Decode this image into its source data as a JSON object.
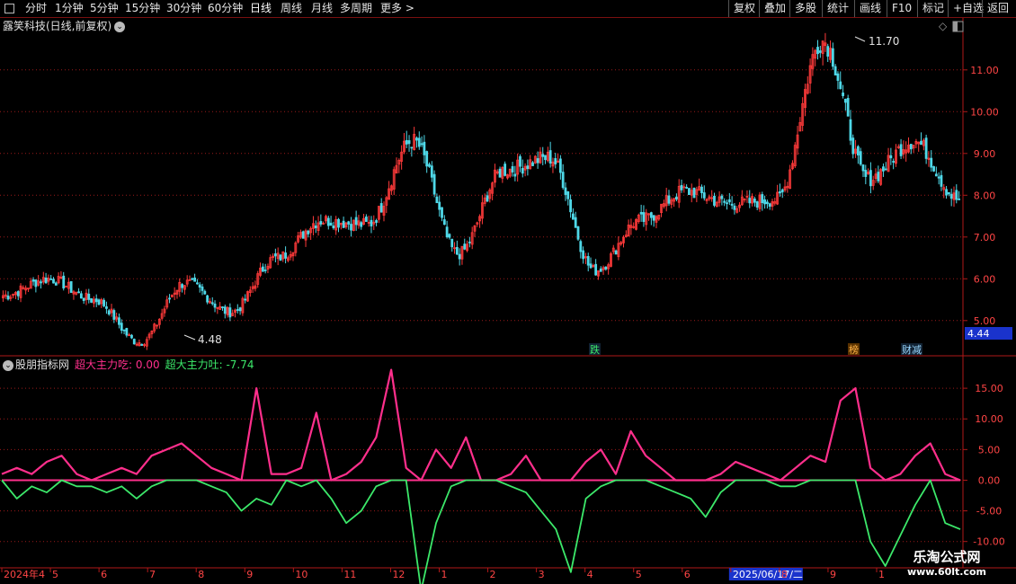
{
  "toolbar": {
    "periods": [
      "分时",
      "1分钟",
      "5分钟",
      "15分钟",
      "30分钟",
      "60分钟",
      "日线",
      "周线",
      "月线",
      "多周期",
      "更多 >"
    ],
    "active_period": "日线",
    "right_buttons": [
      "复权",
      "叠加",
      "多股",
      "统计",
      "画线",
      "F10",
      "标记",
      "+自选",
      "返回"
    ]
  },
  "main_panel": {
    "title": "露笑科技(日线,前复权)",
    "max_label": "11.70",
    "min_label": "4.48",
    "current_price": "4.44"
  },
  "events": [
    "跌",
    "榜",
    "财减"
  ],
  "indicator": {
    "name": "股朋指标网",
    "series1": "超大主力吃: 0.00",
    "series2": "超大主力吐: -7.74"
  },
  "x_axis": [
    "2024年4",
    "5",
    "6",
    "7",
    "8",
    "9",
    "10",
    "11",
    "12",
    "1",
    "2",
    "3",
    "4",
    "5",
    "6",
    "2025/06/17/二",
    "8",
    "9",
    "1"
  ],
  "logo": {
    "name": "乐淘公式网",
    "url": "www.60lt.com"
  },
  "colors": {
    "up": "#ff3a3a",
    "down": "#4fd8e8",
    "series1": "#ff2f8c",
    "series2": "#3ce86a",
    "grid": "#9a1a1a"
  },
  "chart_data": [
    {
      "type": "candlestick",
      "title": "露笑科技(日线,前复权)",
      "y_axis_ticks": [
        5.0,
        6.0,
        7.0,
        8.0,
        9.0,
        10.0,
        11.0
      ],
      "ylim": [
        4.2,
        12.2
      ],
      "key_points": [
        {
          "x": "2024-04",
          "y": 5.6
        },
        {
          "x": "2024-05",
          "y": 6.0
        },
        {
          "x": "2024-06",
          "y": 5.5
        },
        {
          "x": "2024-07",
          "y": 4.48
        },
        {
          "x": "2024-08",
          "y": 5.9
        },
        {
          "x": "2024-09",
          "y": 5.2
        },
        {
          "x": "2024-10",
          "y": 6.5
        },
        {
          "x": "2024-11",
          "y": 7.4
        },
        {
          "x": "2024-12",
          "y": 7.3
        },
        {
          "x": "2025-01",
          "y": 9.3
        },
        {
          "x": "2025-01",
          "y": 6.6
        },
        {
          "x": "2025-02",
          "y": 8.6
        },
        {
          "x": "2025-03",
          "y": 8.9
        },
        {
          "x": "2025-04",
          "y": 6.2
        },
        {
          "x": "2025-05",
          "y": 7.4
        },
        {
          "x": "2025-06",
          "y": 8.1
        },
        {
          "x": "2025-07",
          "y": 7.8
        },
        {
          "x": "2025-08",
          "y": 7.9
        },
        {
          "x": "2025-09",
          "y": 11.7
        },
        {
          "x": "2025-10",
          "y": 8.4
        },
        {
          "x": "2025-10",
          "y": 9.3
        },
        {
          "x": "2025-11",
          "y": 7.9
        }
      ]
    },
    {
      "type": "line",
      "y_axis_ticks": [
        15.0,
        10.0,
        5.0,
        0.0,
        -5.0,
        -10.0
      ],
      "ylim": [
        -14,
        20
      ],
      "series": [
        {
          "name": "超大主力吃",
          "values": [
            1,
            2,
            1,
            3,
            4,
            1,
            0,
            1,
            2,
            1,
            4,
            5,
            6,
            4,
            2,
            1,
            0,
            15,
            1,
            1,
            2,
            11,
            0,
            1,
            3,
            7,
            18,
            2,
            0,
            5,
            2,
            7,
            0,
            0,
            1,
            4,
            0,
            0,
            0,
            3,
            5,
            1,
            8,
            4,
            2,
            0,
            0,
            0,
            1,
            3,
            2,
            1,
            0,
            2,
            4,
            3,
            13,
            15,
            2,
            0,
            1,
            4,
            6,
            1,
            0
          ]
        },
        {
          "name": "超大主力吐",
          "values": [
            0,
            -3,
            -1,
            -2,
            0,
            -1,
            -1,
            -2,
            -1,
            -3,
            -1,
            0,
            0,
            0,
            -1,
            -2,
            -5,
            -3,
            -4,
            0,
            -1,
            0,
            -3,
            -7,
            -5,
            -1,
            0,
            0,
            -18,
            -7,
            -1,
            0,
            0,
            0,
            -1,
            -2,
            -5,
            -8,
            -15,
            -3,
            -1,
            0,
            0,
            0,
            -1,
            -2,
            -3,
            -6,
            -2,
            0,
            0,
            0,
            -1,
            -1,
            0,
            0,
            0,
            0,
            -10,
            -14,
            -9,
            -4,
            0,
            -7,
            -8
          ]
        }
      ]
    }
  ]
}
